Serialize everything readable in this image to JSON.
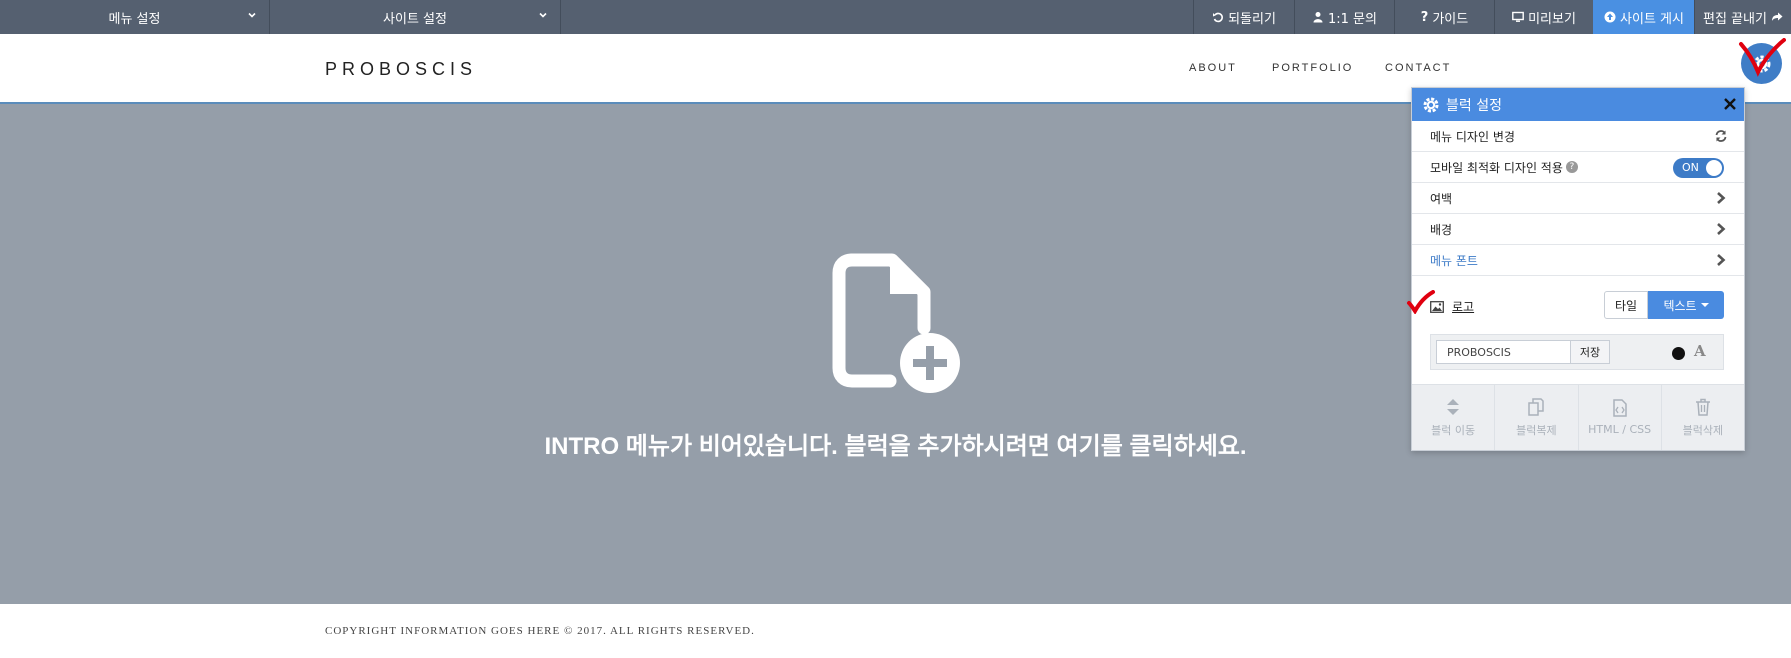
{
  "toolbar": {
    "menu_settings": "메뉴 설정",
    "site_settings": "사이트 설정",
    "undo": "되돌리기",
    "inquiry": "1:1 문의",
    "guide": "가이드",
    "preview": "미리보기",
    "publish": "사이트 게시",
    "finish": "편집 끝내기",
    "publish_color": "#4a90e2"
  },
  "site": {
    "logo": "PROBOSCIS",
    "nav": [
      "ABOUT",
      "PORTFOLIO",
      "CONTACT"
    ],
    "intro_message": "INTRO 메뉴가 비어있습니다. 블럭을 추가하시려면 여기를 클릭하세요.",
    "copyright": "COPYRIGHT INFORMATION GOES HERE © 2017. ALL RIGHTS RESERVED."
  },
  "panel": {
    "title": "블럭 설정",
    "rows": {
      "menu_design": "메뉴 디자인 변경",
      "mobile_opt": "모바일 최적화 디자인 적용",
      "mobile_toggle": "ON",
      "margin": "여백",
      "background": "배경",
      "menu_font": "메뉴 폰트"
    },
    "logo": {
      "label": "로고",
      "tile": "타일",
      "text": "텍스트",
      "input_value": "PROBOSCIS",
      "save": "저장",
      "font_glyph": "A"
    },
    "footer": {
      "move": "블럭 이동",
      "copy": "블럭복제",
      "html_css": "HTML / CSS",
      "delete": "블럭삭제"
    }
  }
}
